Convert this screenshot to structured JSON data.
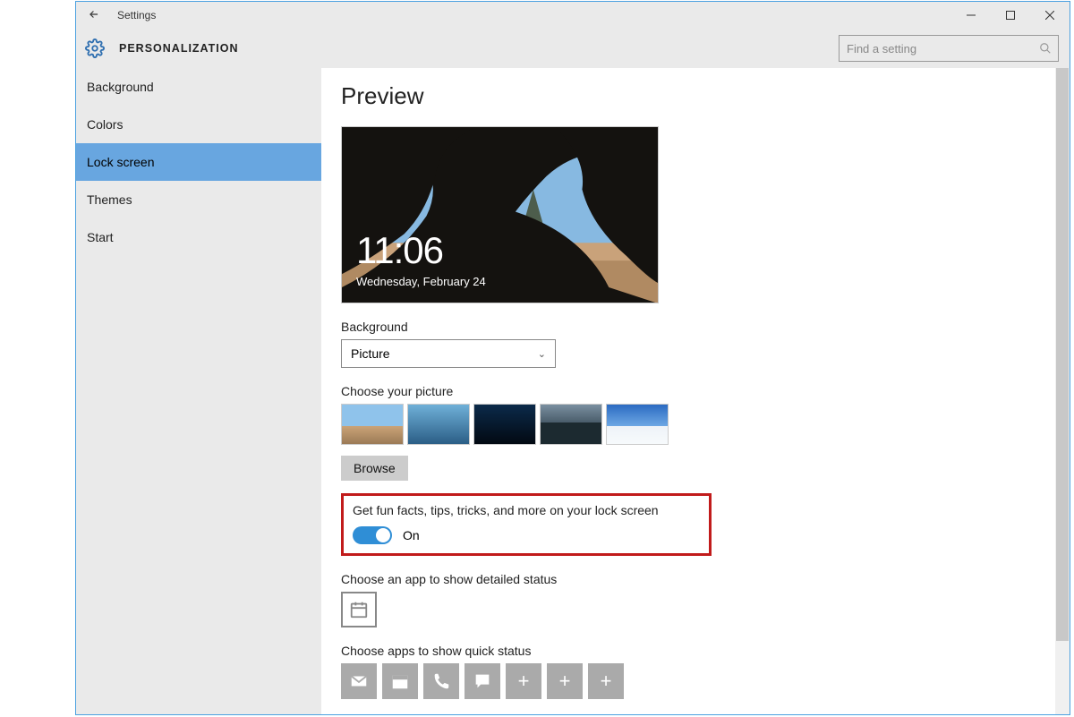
{
  "titlebar": {
    "title": "Settings"
  },
  "header": {
    "section": "PERSONALIZATION",
    "search_placeholder": "Find a setting"
  },
  "sidebar": {
    "items": [
      {
        "label": "Background"
      },
      {
        "label": "Colors"
      },
      {
        "label": "Lock screen"
      },
      {
        "label": "Themes"
      },
      {
        "label": "Start"
      }
    ],
    "selected_index": 2
  },
  "content": {
    "heading": "Preview",
    "preview": {
      "time": "11:06",
      "date": "Wednesday, February 24"
    },
    "background_label": "Background",
    "background_value": "Picture",
    "choose_picture_label": "Choose your picture",
    "browse_label": "Browse",
    "fun_facts_label": "Get fun facts, tips, tricks, and more on your lock screen",
    "fun_facts_state": "On",
    "detailed_status_label": "Choose an app to show detailed status",
    "quick_status_label": "Choose apps to show quick status"
  }
}
